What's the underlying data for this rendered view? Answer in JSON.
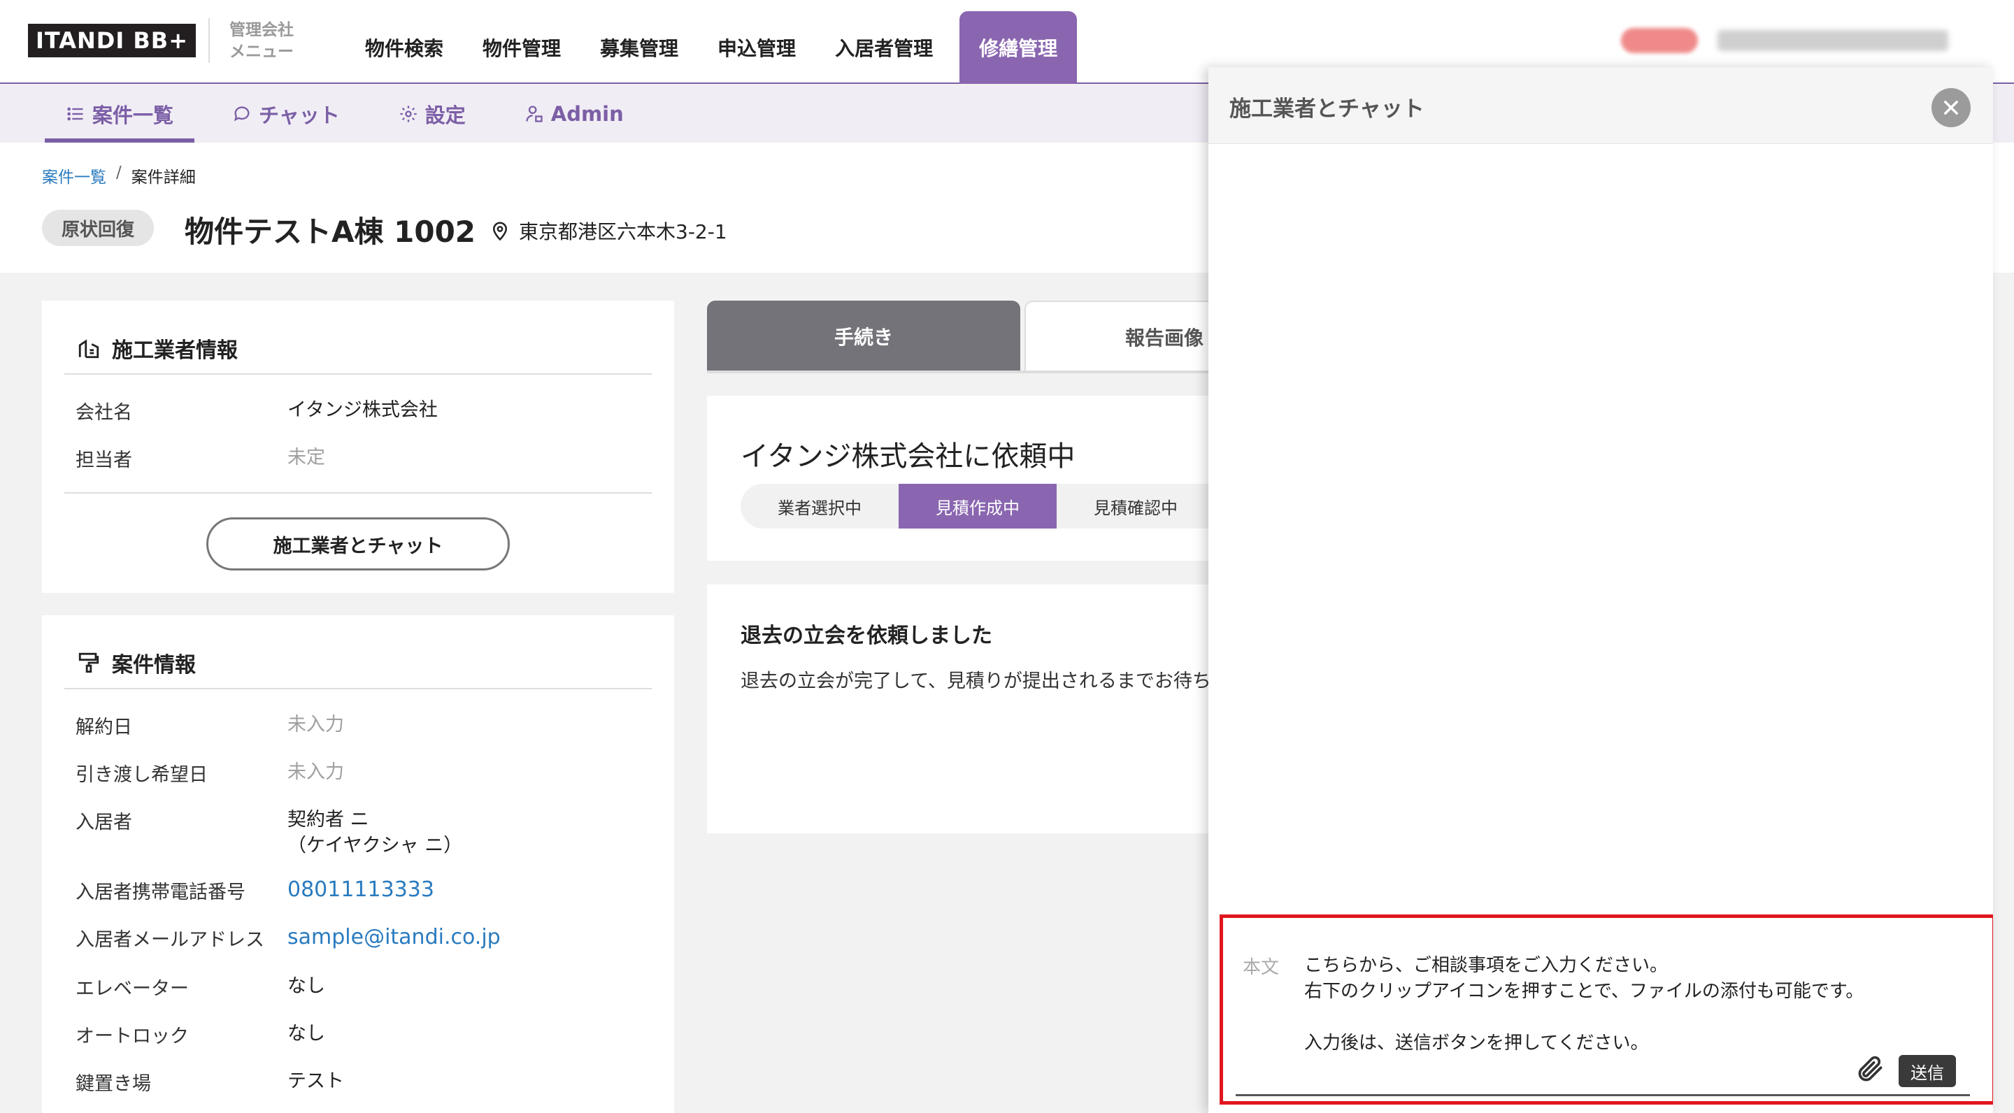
{
  "header": {
    "logo": "ITANDI BB+",
    "menu_label": "管理会社\nメニュー",
    "nav": [
      "物件検索",
      "物件管理",
      "募集管理",
      "申込管理",
      "入居者管理",
      "修繕管理"
    ],
    "active_nav": "修繕管理"
  },
  "subnav": {
    "items": [
      "案件一覧",
      "チャット",
      "設定",
      "Admin"
    ]
  },
  "page": {
    "breadcrumb": [
      "案件一覧",
      "案件詳細"
    ],
    "breadcrumb_sep": "/",
    "type": "原状回復",
    "title": "物件テストA棟 1002",
    "address": "東京都港区六本木3-2-1"
  },
  "contractor": {
    "title": "施工業者情報",
    "rows": [
      {
        "label": "会社名",
        "value": "イタンジ株式会社"
      },
      {
        "label": "担当者",
        "value": "未定"
      }
    ],
    "chat_button": "施工業者とチャット"
  },
  "case": {
    "title": "案件情報",
    "rows": [
      {
        "label": "解約日",
        "value": "未入力"
      },
      {
        "label": "引き渡し希望日",
        "value": "未入力"
      },
      {
        "label": "入居者",
        "value": "契約者 ニ\n（ケイヤクシャ ニ）"
      },
      {
        "label": "入居者携帯電話番号",
        "value": "08011113333"
      },
      {
        "label": "入居者メールアドレス",
        "value": "sample@itandi.co.jp"
      },
      {
        "label": "エレベーター",
        "value": "なし"
      },
      {
        "label": "オートロック",
        "value": "なし"
      },
      {
        "label": "鍵置き場",
        "value": "テスト"
      }
    ]
  },
  "tabs": [
    "手続き",
    "報告画像"
  ],
  "status": {
    "title": "イタンジ株式会社に依頼中",
    "steps": [
      "業者選択中",
      "見積作成中",
      "見積確認中"
    ],
    "active_step": "見積作成中"
  },
  "message": {
    "title": "退去の立会を依頼しました",
    "body": "退去の立会が完了して、見積りが提出されるまでお待ちください。"
  },
  "chat": {
    "title": "施工業者とチャット",
    "composer_label": "本文",
    "composer_placeholder": "こちらから、ご相談事項をご入力ください。\n右下のクリップアイコンを押すことで、ファイルの添付も可能です。\n\n入力後は、送信ボタンを押してください。",
    "send_label": "送信"
  },
  "colors": {
    "accent": "#8a66b0",
    "link": "#2a7bbf",
    "highlight": "#e0161f"
  }
}
